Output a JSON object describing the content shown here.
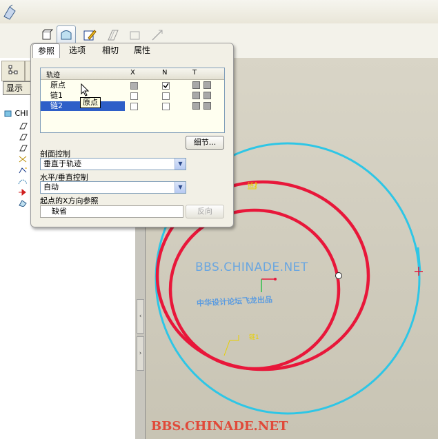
{
  "toolbar": {
    "icons": [
      "sweep-solid-icon",
      "sweep-surface-icon",
      "sketch-edit-icon",
      "thin-icon",
      "remove-material-icon",
      "trim-icon"
    ]
  },
  "left_panel": {
    "display_button": "显示",
    "tree_root": "CHI"
  },
  "dialog": {
    "tabs": [
      "参照",
      "选项",
      "相切",
      "属性"
    ],
    "grid": {
      "headers": {
        "name": "轨迹",
        "x": "X",
        "n": "N",
        "t": "T"
      },
      "rows": [
        {
          "name": "原点",
          "x": "grey",
          "n": true
        },
        {
          "name": "链1",
          "x": false,
          "n": false
        },
        {
          "name": "链2",
          "x": false,
          "n": false
        }
      ]
    },
    "tooltip": "原点",
    "details_button": "细节...",
    "section_control_label": "剖面控制",
    "section_control_value": "垂直于轨迹",
    "hv_control_label": "水平/垂直控制",
    "hv_control_value": "自动",
    "x_ref_label": "起点的X方向参照",
    "x_ref_value": "缺省",
    "flip_button": "反向"
  },
  "canvas": {
    "watermark_en": "BBS.CHINADE.NET",
    "watermark_cn": "中华设计论坛飞龙出品",
    "watermark_bottom": "BBS.CHINADE.NET",
    "chain2_label": "链2",
    "chain1_label": "链1",
    "colors": {
      "chain": "#e8173a",
      "origin_trajectory": "#2ec6e6",
      "labels": "#e8d000"
    }
  }
}
